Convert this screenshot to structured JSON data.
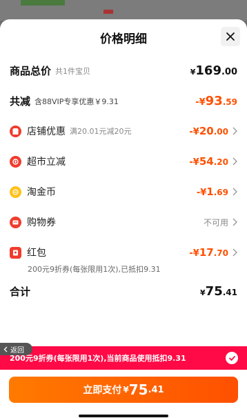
{
  "header": {
    "title": "价格明细"
  },
  "goods_total": {
    "label": "商品总价",
    "count": "共1件宝贝",
    "currency": "¥",
    "integer": "169",
    "decimal": ".00"
  },
  "discount_total": {
    "label": "共减",
    "desc": "含88VIP专享优惠￥9.31",
    "prefix": "-¥",
    "integer": "93",
    "decimal": ".59"
  },
  "items": [
    {
      "label": "店铺优惠",
      "desc": "满20.01元减20元",
      "prefix": "-¥",
      "integer": "20",
      "decimal": ".00"
    },
    {
      "label": "超市立减",
      "prefix": "-¥",
      "integer": "54",
      "decimal": ".20"
    },
    {
      "label": "淘金币",
      "prefix": "-¥",
      "integer": "1",
      "decimal": ".69"
    },
    {
      "label": "购物券",
      "status": "不可用"
    },
    {
      "label": "红包",
      "prefix": "-¥",
      "integer": "17",
      "decimal": ".70",
      "note": "200元9折券(每张限用1次),已抵扣9.31"
    }
  ],
  "sum": {
    "label": "合计",
    "currency": "¥",
    "integer": "75",
    "decimal": ".41"
  },
  "back_label": "返回",
  "promo_bar": {
    "text": "200元9折券(每张限用1次),当前商品使用抵扣9.31"
  },
  "pay_button": {
    "label": "立即支付",
    "currency": "¥",
    "integer": "75",
    "decimal": ".41"
  },
  "colors": {
    "accent": "#ff5000",
    "promo": "#ff0a46",
    "icon_red": "#f03c2e",
    "icon_gold": "#ffc21a"
  }
}
